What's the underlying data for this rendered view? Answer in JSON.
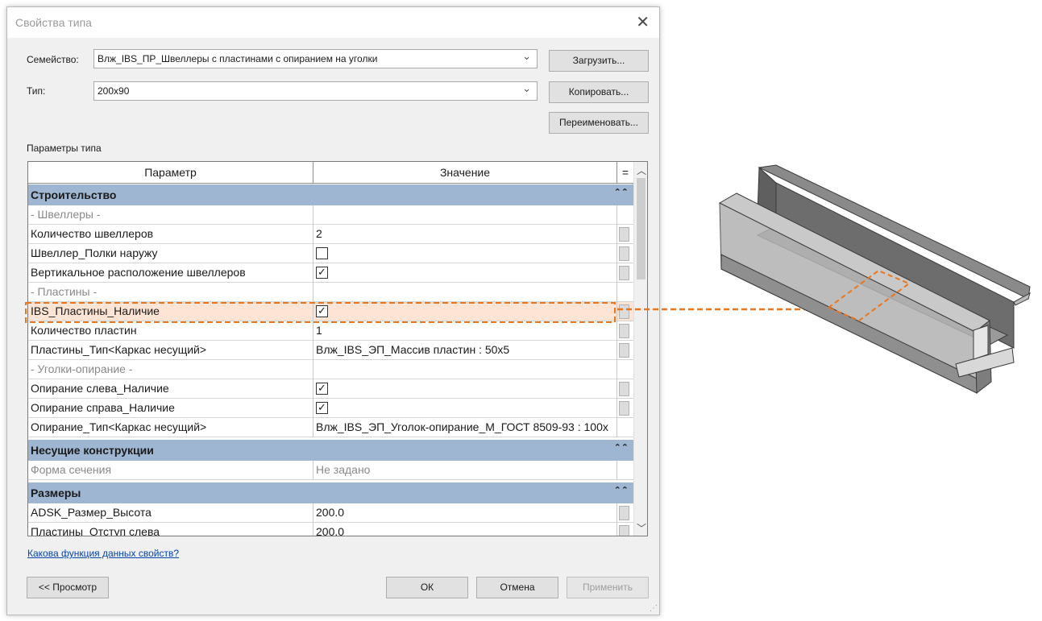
{
  "dialog": {
    "title": "Свойства типа",
    "close_icon": "close-icon"
  },
  "family": {
    "label": "Семейство:",
    "value": "Влж_IBS_ПР_Швеллеры с пластинами с опиранием на уголки"
  },
  "type": {
    "label": "Тип:",
    "value": "200x90"
  },
  "buttons": {
    "load": "Загрузить...",
    "copy": "Копировать...",
    "rename": "Переименовать...",
    "preview": "<< Просмотр",
    "ok": "ОК",
    "cancel": "Отмена",
    "apply": "Применить"
  },
  "params_label": "Параметры типа",
  "table": {
    "headers": [
      "Параметр",
      "Значение",
      "="
    ],
    "groups": {
      "construction": "Строительство",
      "bearing": "Несущие конструкции",
      "sizes": "Размеры"
    },
    "rows": {
      "channels_sub": "- Швеллеры -",
      "channels_count_label": "Количество швеллеров",
      "channels_count_value": "2",
      "channel_flanges_label": "Швеллер_Полки наружу",
      "vertical_layout_label": "Вертикальное расположение швеллеров",
      "plates_sub": "- Пластины -",
      "plates_presence_label": "IBS_Пластины_Наличие",
      "plates_count_label": "Количество пластин",
      "plates_count_value": "1",
      "plates_type_label": "Пластины_Тип<Каркас несущий>",
      "plates_type_value": "Влж_IBS_ЭП_Массив пластин : 50x5",
      "angles_sub": "- Уголки-опирание -",
      "support_left_label": "Опирание слева_Наличие",
      "support_right_label": "Опирание справа_Наличие",
      "support_type_label": "Опирание_Тип<Каркас несущий>",
      "support_type_value": "Влж_IBS_ЭП_Уголок-опирание_М_ГОСТ 8509-93 : 100x",
      "section_shape_label": "Форма сечения",
      "section_shape_value": "Не задано",
      "height_label": "ADSK_Размер_Высота",
      "height_value": "200.0",
      "partial_label": "Пластины_Отступ слева",
      "partial_value": "200.0"
    },
    "checkboxes": {
      "channel_flanges": false,
      "vertical_layout": true,
      "plates_presence": true,
      "support_left": true,
      "support_right": true
    }
  },
  "help_link": "Какова функция данных свойств?",
  "colors": {
    "group_header": "#9fb6d2",
    "highlight_row": "#fde4d4",
    "callout": "#e87722"
  }
}
